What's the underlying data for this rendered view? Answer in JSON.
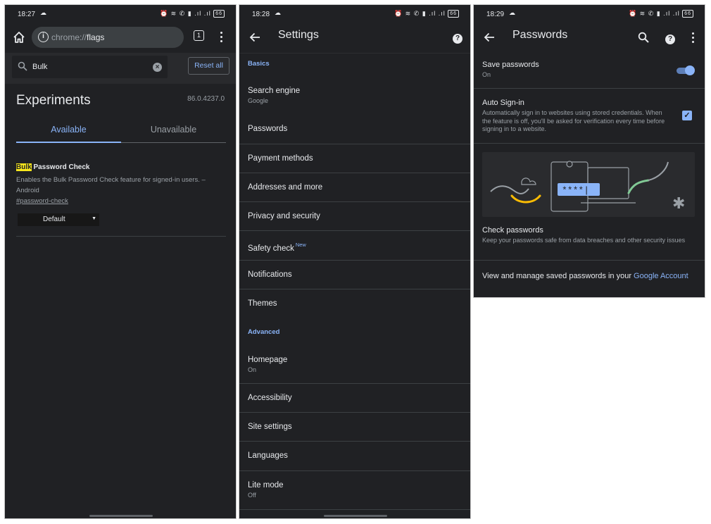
{
  "panel1": {
    "status": {
      "time": "18:27",
      "battery": "66"
    },
    "omnibox": {
      "scheme": "chrome://",
      "host": "flags"
    },
    "tab_count": "1",
    "search": {
      "value": "Bulk"
    },
    "reset_label": "Reset all",
    "title": "Experiments",
    "version": "86.0.4237.0",
    "tabs": {
      "available": "Available",
      "unavailable": "Unavailable"
    },
    "flag": {
      "title_highlight": "Bulk",
      "title_rest": " Password Check",
      "description": "Enables the Bulk Password Check feature for signed-in users. – Android",
      "link": "#password-check",
      "selected": "Default"
    }
  },
  "panel2": {
    "status": {
      "time": "18:28",
      "battery": "66"
    },
    "title": "Settings",
    "sections": {
      "basics": "Basics",
      "advanced": "Advanced"
    },
    "items": [
      {
        "label": "Search engine",
        "sub": "Google"
      },
      {
        "label": "Passwords",
        "sub": ""
      },
      {
        "label": "Payment methods",
        "sub": ""
      },
      {
        "label": "Addresses and more",
        "sub": ""
      },
      {
        "label": "Privacy and security",
        "sub": ""
      },
      {
        "label": "Safety check",
        "sub": "",
        "badge": "New"
      },
      {
        "label": "Notifications",
        "sub": ""
      },
      {
        "label": "Themes",
        "sub": ""
      },
      {
        "label": "Homepage",
        "sub": "On"
      },
      {
        "label": "Accessibility",
        "sub": ""
      },
      {
        "label": "Site settings",
        "sub": ""
      },
      {
        "label": "Languages",
        "sub": ""
      },
      {
        "label": "Lite mode",
        "sub": "Off"
      }
    ]
  },
  "panel3": {
    "status": {
      "time": "18:29",
      "battery": "66"
    },
    "title": "Passwords",
    "save": {
      "label": "Save passwords",
      "sub": "On",
      "enabled": true
    },
    "autosignin": {
      "label": "Auto Sign-in",
      "desc": "Automatically sign in to websites using stored credentials. When the feature is off, you'll be asked for verification every time before signing in to a website.",
      "checked": true
    },
    "illustration": {
      "masked": "****|"
    },
    "check": {
      "label": "Check passwords",
      "desc": "Keep your passwords safe from data breaches and other security issues"
    },
    "manage": {
      "prefix": "View and manage saved passwords in your ",
      "link": "Google Account"
    }
  },
  "colors": {
    "accent": "#8ab4f8",
    "background": "#202124",
    "highlight": "#f8e71c"
  }
}
